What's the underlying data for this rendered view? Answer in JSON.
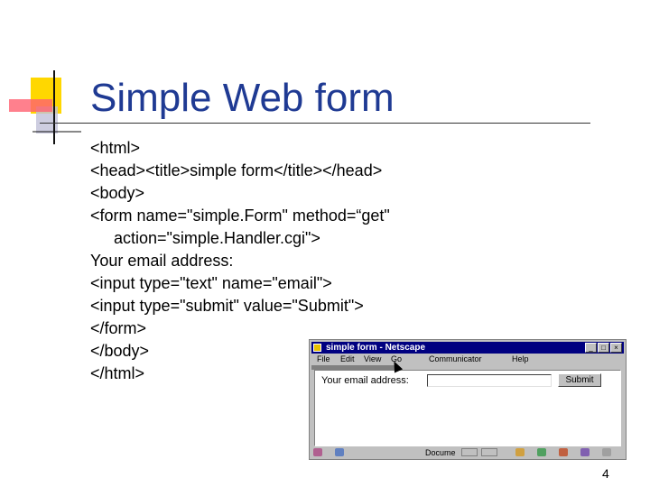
{
  "slide": {
    "title": "Simple Web form",
    "page_number": "4",
    "code_lines": [
      "<html>",
      "<head><title>simple form</title></head>",
      "<body>",
      "<form name=\"simple.Form\" method=“get\"",
      "action=\"simple.Handler.cgi\">",
      "Your email address:",
      "<input type=\"text\" name=\"email\">",
      "<input type=\"submit\" value=\"Submit\">",
      "</form>",
      "</body>",
      "</html>"
    ]
  },
  "browser": {
    "title": "simple form - Netscape",
    "menu": [
      "File",
      "Edit",
      "View",
      "Go",
      "Communicator",
      "Help"
    ],
    "email_label": "Your email address:",
    "submit_label": "Submit",
    "status_text": "Docume",
    "colors": {
      "titlebar": "#000080",
      "chrome": "#c0c0c0"
    }
  }
}
